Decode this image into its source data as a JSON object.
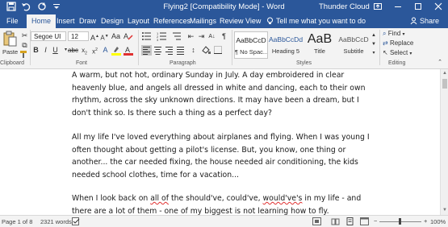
{
  "window": {
    "title": "Flying2 [Compatibility Mode] - Word",
    "user": "Thunder Cloud"
  },
  "tabs": [
    {
      "label": "File"
    },
    {
      "label": "Home"
    },
    {
      "label": "Insert"
    },
    {
      "label": "Draw"
    },
    {
      "label": "Design"
    },
    {
      "label": "Layout"
    },
    {
      "label": "References"
    },
    {
      "label": "Mailings"
    },
    {
      "label": "Review"
    },
    {
      "label": "View"
    }
  ],
  "tell_me": "Tell me what you want to do",
  "share_label": "Share",
  "ribbon": {
    "clipboard": {
      "paste_label": "Paste",
      "group_label": "Clipboard"
    },
    "font": {
      "font_name": "Segoe UI",
      "font_size": "12",
      "group_label": "Font"
    },
    "paragraph": {
      "group_label": "Paragraph"
    },
    "styles": {
      "group_label": "Styles",
      "items": [
        {
          "sample": "AaBbCcD",
          "name": "¶ No Spac..."
        },
        {
          "sample": "AaBbCcDd",
          "name": "Heading 5"
        },
        {
          "sample": "AaB",
          "name": "Title"
        },
        {
          "sample": "AaBbCcD",
          "name": "Subtitle"
        }
      ]
    },
    "editing": {
      "find_label": "Find",
      "replace_label": "Replace",
      "select_label": "Select",
      "group_label": "Editing"
    }
  },
  "document": {
    "paragraphs": [
      "A warm, but not hot, ordinary Sunday in July. A day embroidered in clear heavenly blue, and angels all dressed in white and dancing, each to their own rhythm, across the sky unknown directions. It may have been a dream, but I don't think so. Is there such a thing as a perfect day?",
      "All my life I've loved everything about airplanes and flying. When I was young I often thought about getting a pilot's license. But, you know, one thing or another... the car needed fixing, the house needed air conditioning, the kids needed school clothes, time for a vacation...",
      {
        "before": "When I look back on ",
        "w1": "all of",
        "mid": " the should've, could've, ",
        "w2": "would've's",
        "after": " in my life - and there are a lot of them - one of my biggest is not learning how to fly."
      }
    ]
  },
  "status": {
    "page": "Page 1 of 8",
    "words": "2321 words",
    "zoom": "100%",
    "zoom_minus": "−",
    "zoom_plus": "+"
  },
  "colors": {
    "accent": "#2b579a",
    "ribbon_bg": "#f3f3f3",
    "highlight_yellow": "#ffff00",
    "font_color_red": "#e03030"
  }
}
